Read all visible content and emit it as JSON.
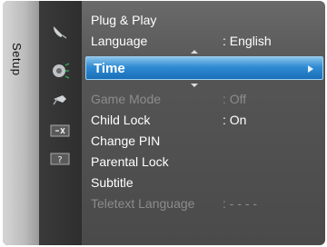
{
  "tab": {
    "label": "Setup"
  },
  "icons": [
    "picture-icon",
    "sound-icon",
    "setup-icon",
    "channel-icon",
    "input-icon",
    "help-icon"
  ],
  "menu": {
    "items": [
      {
        "label": "Plug & Play",
        "value": ""
      },
      {
        "label": "Language",
        "value": ": English"
      },
      {
        "label": "Time",
        "value": ""
      },
      {
        "label": "Game Mode",
        "value": ": Off"
      },
      {
        "label": "Child Lock",
        "value": ": On"
      },
      {
        "label": "Change PIN",
        "value": ""
      },
      {
        "label": "Parental Lock",
        "value": ""
      },
      {
        "label": "Subtitle",
        "value": ""
      },
      {
        "label": "Teletext Language",
        "value": ": - - - -"
      }
    ],
    "selected_index": 2
  },
  "colors": {
    "highlight": "#2f8bd3",
    "text": "#ffffff",
    "disabled": "#8c8c8c"
  }
}
